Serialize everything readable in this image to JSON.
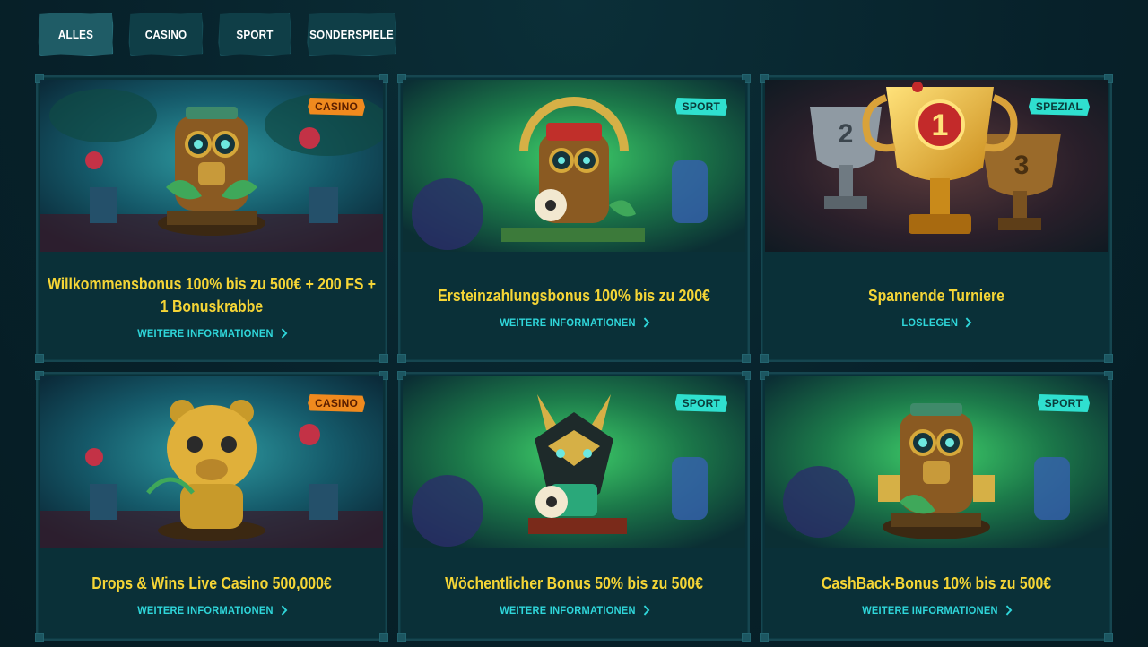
{
  "tabs": [
    {
      "label": "ALLES",
      "active": true
    },
    {
      "label": "CASINO",
      "active": false
    },
    {
      "label": "SPORT",
      "active": false
    },
    {
      "label": "SONDERSPIELE",
      "active": false
    }
  ],
  "cards": [
    {
      "badge": "CASINO",
      "title": "Willkommensbonus 100% bis zu 500€ + 200 FS + 1 Bonuskrabbe",
      "link": "WEITERE INFORMATIONEN",
      "image": "monkey-idol-casino"
    },
    {
      "badge": "SPORT",
      "title": "Ersteinzahlungsbonus 100% bis zu 200€",
      "link": "WEITERE INFORMATIONEN",
      "image": "monkey-idol-soccer"
    },
    {
      "badge": "SPEZIAL",
      "title": "Spannende Turniere",
      "link": "LOSLEGEN",
      "image": "trophies",
      "trophy_numbers": [
        "2",
        "1",
        "3"
      ]
    },
    {
      "badge": "CASINO",
      "title": "Drops & Wins Live Casino 500,000€",
      "link": "WEITERE INFORMATIONEN",
      "image": "bear-idol-casino"
    },
    {
      "badge": "SPORT",
      "title": "Wöchentlicher Bonus 50% bis zu 500€",
      "link": "WEITERE INFORMATIONEN",
      "image": "jackal-idol-soccer"
    },
    {
      "badge": "SPORT",
      "title": "CashBack-Bonus 10% bis zu 500€",
      "link": "WEITERE INFORMATIONEN",
      "image": "monkey-idol-sport"
    }
  ],
  "colors": {
    "background": "#07222a",
    "card": "#0a3038",
    "title": "#f5d536",
    "link": "#2fd6da",
    "badge_casino": "#f08a1e",
    "badge_sport": "#2fe0cf"
  },
  "icons": {
    "link_arrow": "chevron-right-icon"
  }
}
